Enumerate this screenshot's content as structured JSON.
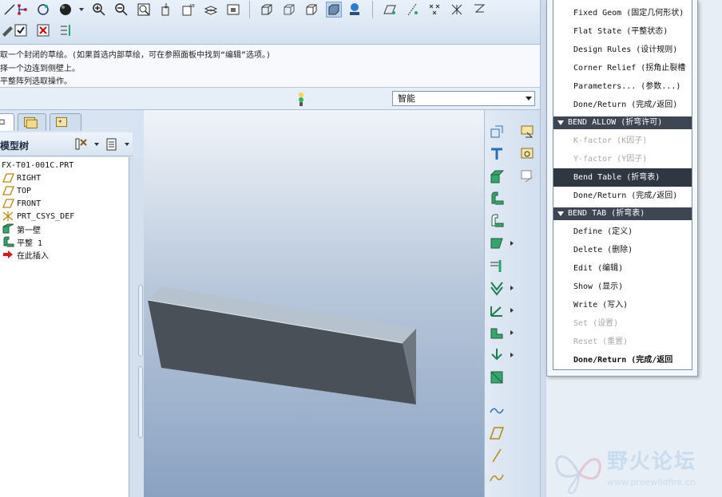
{
  "messages": [
    "取一个封闭的草绘。(如果首选内部草绘，可在参照面板中找到“编辑”选项。)",
    "择一个边连到侧壁上。",
    "平整阵列选取操作。"
  ],
  "filter": {
    "value": "智能"
  },
  "model_tree": {
    "title": "模型树",
    "items": [
      {
        "label": "FX-T01-001C.PRT",
        "icon": "part-icon"
      },
      {
        "label": "RIGHT",
        "icon": "datum-plane-icon"
      },
      {
        "label": "TOP",
        "icon": "datum-plane-icon"
      },
      {
        "label": "FRONT",
        "icon": "datum-plane-icon"
      },
      {
        "label": "PRT_CSYS_DEF",
        "icon": "csys-icon"
      },
      {
        "label": "第一壁",
        "icon": "first-wall-icon"
      },
      {
        "label": "平整 1",
        "icon": "flat-wall-icon"
      },
      {
        "label": "在此插入",
        "icon": "insert-here-icon"
      }
    ]
  },
  "menu_manager": {
    "items_top": [
      {
        "label": "Fixed Geom (固定几何形状)",
        "state": "normal"
      },
      {
        "label": "Flat State (平整状态)",
        "state": "normal"
      },
      {
        "label": "Design Rules (设计规则)",
        "state": "normal"
      },
      {
        "label": "Corner Relief (拐角止裂槽",
        "state": "normal"
      },
      {
        "label": "Parameters... (参数...)",
        "state": "normal"
      },
      {
        "label": "Done/Return (完成/返回)",
        "state": "normal"
      }
    ],
    "bend_allow": {
      "header": "BEND ALLOW (折弯许可)",
      "items": [
        {
          "label": "K-factor (K因子)",
          "state": "disabled"
        },
        {
          "label": "Y-factor (Y因子)",
          "state": "disabled"
        },
        {
          "label": "Bend Table (折弯表)",
          "state": "selected"
        },
        {
          "label": "Done/Return (完成/返回)",
          "state": "normal"
        }
      ]
    },
    "bend_tab": {
      "header": "BEND TAB (折弯表)",
      "items": [
        {
          "label": "Define (定义)",
          "state": "normal"
        },
        {
          "label": "Delete (删除)",
          "state": "normal"
        },
        {
          "label": "Edit (编辑)",
          "state": "normal"
        },
        {
          "label": "Show (显示)",
          "state": "normal"
        },
        {
          "label": "Write (写入)",
          "state": "normal"
        },
        {
          "label": "Set (设置)",
          "state": "disabled"
        },
        {
          "label": "Reset (重置)",
          "state": "disabled"
        },
        {
          "label": "Done/Return (完成/返回",
          "state": "bold"
        }
      ]
    }
  },
  "watermark": {
    "title": "野火论坛",
    "url": "www.proewildfire.cn"
  },
  "colors": {
    "accent": "#2f3742",
    "viewport_top": "#f0f4f9",
    "viewport_bottom": "#8aa2c1",
    "part_face": "#b3bfcb",
    "part_side": "#4a5058"
  }
}
